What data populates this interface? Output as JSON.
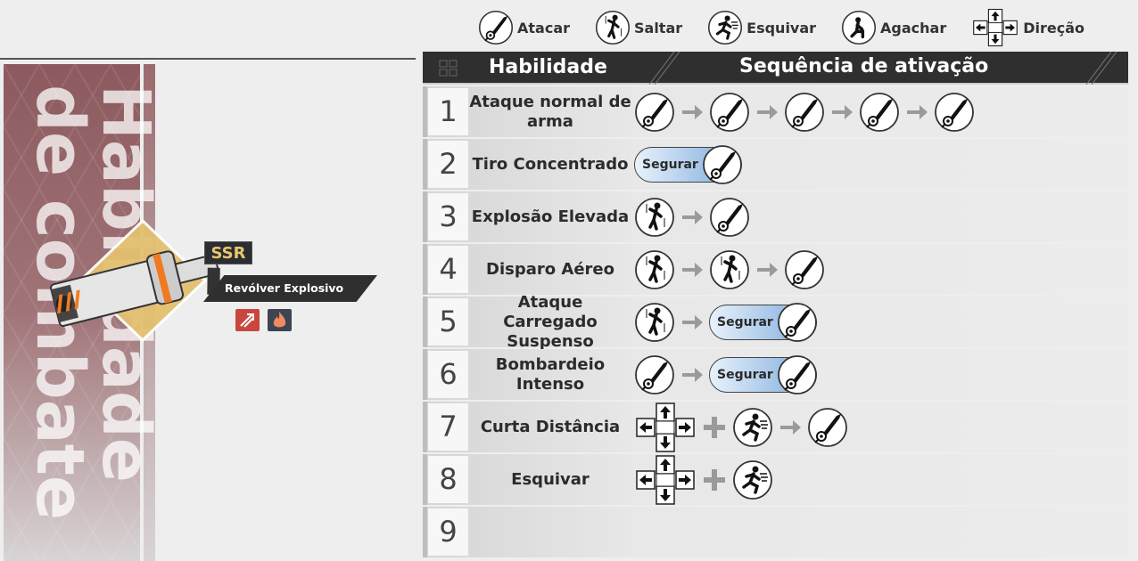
{
  "legend": [
    {
      "icon": "atk",
      "label": "Atacar"
    },
    {
      "icon": "jump",
      "label": "Saltar"
    },
    {
      "icon": "dodge",
      "label": "Esquivar"
    },
    {
      "icon": "crouch",
      "label": "Agachar"
    },
    {
      "icon": "dir",
      "label": "Direção"
    }
  ],
  "panel": {
    "title": "Habilidade\nde combate",
    "rarity": "SSR",
    "weapon_name": "Revólver Explosivo"
  },
  "table": {
    "col_skill": "Habilidade",
    "col_sequence": "Sequência de ativação",
    "hold_label": "Segurar",
    "rows": [
      {
        "num": "1",
        "name": "Ataque normal de arma",
        "seq": [
          "atk",
          "arrow",
          "atk",
          "arrow",
          "atk",
          "arrow",
          "atk",
          "arrow",
          "atk"
        ]
      },
      {
        "num": "2",
        "name": "Tiro Concentrado",
        "seq": [
          "hold"
        ]
      },
      {
        "num": "3",
        "name": "Explosão Elevada",
        "seq": [
          "jump",
          "arrow",
          "atk"
        ]
      },
      {
        "num": "4",
        "name": "Disparo Aéreo",
        "seq": [
          "jump",
          "arrow",
          "jump",
          "arrow",
          "atk"
        ]
      },
      {
        "num": "5",
        "name": "Ataque Carregado Suspenso",
        "seq": [
          "jump",
          "arrow",
          "hold"
        ]
      },
      {
        "num": "6",
        "name": "Bombardeio Intenso",
        "seq": [
          "atk",
          "arrow",
          "hold"
        ]
      },
      {
        "num": "7",
        "name": "Curta Distância",
        "seq": [
          "dir",
          "plus",
          "dodge",
          "arrow",
          "atk"
        ]
      },
      {
        "num": "8",
        "name": "Esquivar",
        "seq": [
          "dir",
          "plus",
          "dodge"
        ]
      },
      {
        "num": "9",
        "name": "",
        "seq": []
      }
    ]
  },
  "colors": {
    "banner": "#8c5a5e",
    "header": "#2f2f2f",
    "rarity": "#e8c66c",
    "hold": "#7aa8dc"
  }
}
